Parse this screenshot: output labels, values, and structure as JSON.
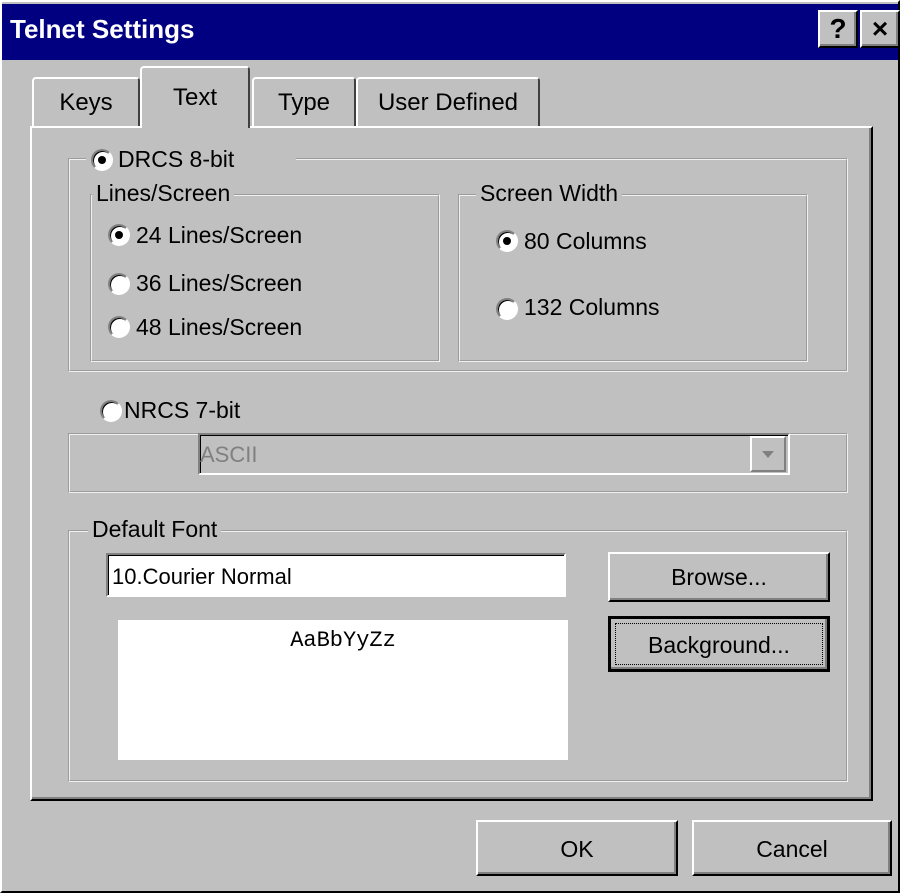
{
  "window": {
    "title": "Telnet Settings",
    "help_label": "?",
    "close_label": "×"
  },
  "tabs": [
    {
      "label": "Keys",
      "active": false
    },
    {
      "label": "Text",
      "active": true
    },
    {
      "label": "Type",
      "active": false
    },
    {
      "label": "User Defined",
      "active": false
    }
  ],
  "drcs": {
    "label": "DRCS 8-bit",
    "selected": true,
    "lines_group": {
      "label": "Lines/Screen",
      "options": [
        {
          "label": "24 Lines/Screen",
          "selected": true
        },
        {
          "label": "36 Lines/Screen",
          "selected": false
        },
        {
          "label": "48 Lines/Screen",
          "selected": false
        }
      ]
    },
    "width_group": {
      "label": "Screen Width",
      "options": [
        {
          "label": "80 Columns",
          "selected": true
        },
        {
          "label": "132 Columns",
          "selected": false
        }
      ]
    }
  },
  "nrcs": {
    "label": "NRCS 7-bit",
    "selected": false,
    "dropdown_value": "ASCII"
  },
  "default_font": {
    "label": "Default Font",
    "value": "10.Courier Normal",
    "browse_label": "Browse...",
    "background_label": "Background...",
    "preview_text": "AaBbYyZz"
  },
  "buttons": {
    "ok_label": "OK",
    "cancel_label": "Cancel"
  },
  "colors": {
    "titlebar": "#000080",
    "face": "#c0c0c0"
  }
}
